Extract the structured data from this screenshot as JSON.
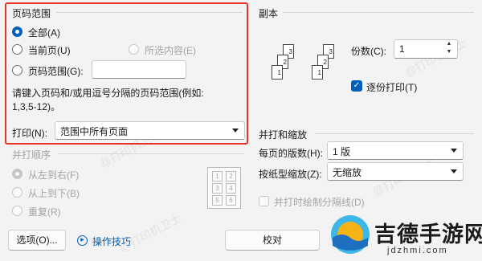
{
  "print_range": {
    "title": "页码范围",
    "all": "全部(A)",
    "current_page": "当前页(U)",
    "selection": "所选内容(E)",
    "pages": "页码范围(G):",
    "pages_value": "",
    "hint_line1": "请键入页码和/或用逗号分隔的页码范围(例如:",
    "hint_line2": "1,3,5-12)。",
    "print_label": "打印(N):",
    "print_value": "范围中所有页面"
  },
  "collate": {
    "title": "并打顺序",
    "left_to_right": "从左到右(F)",
    "top_to_bottom": "从上到下(B)",
    "repeat": "重复(R)",
    "grid": [
      "1",
      "2",
      "3",
      "4",
      "5",
      "6"
    ]
  },
  "copies": {
    "title": "副本",
    "count_label": "份数(C):",
    "count_value": "1",
    "collate_label": "逐份打印(T)",
    "collate_checked": true,
    "pages_a": [
      "3",
      "2",
      "1"
    ],
    "pages_b": [
      "3",
      "2",
      "1"
    ]
  },
  "zoom": {
    "title": "并打和缩放",
    "per_sheet_label": "每页的版数(H):",
    "per_sheet_value": "1 版",
    "scale_label": "按纸型缩放(Z):",
    "scale_value": "无缩放",
    "draw_borders": "并打时绘制分隔线(D)"
  },
  "footer": {
    "options_button": "选项(O)...",
    "tips_link": "操作技巧",
    "ok_button": "校对"
  },
  "watermark": {
    "text": "@打印机卫士",
    "logo_text": "吉德手游网",
    "logo_url": "jdzhmi.com"
  },
  "colors": {
    "accent": "#005fb8",
    "highlight_border": "#e8352b"
  }
}
